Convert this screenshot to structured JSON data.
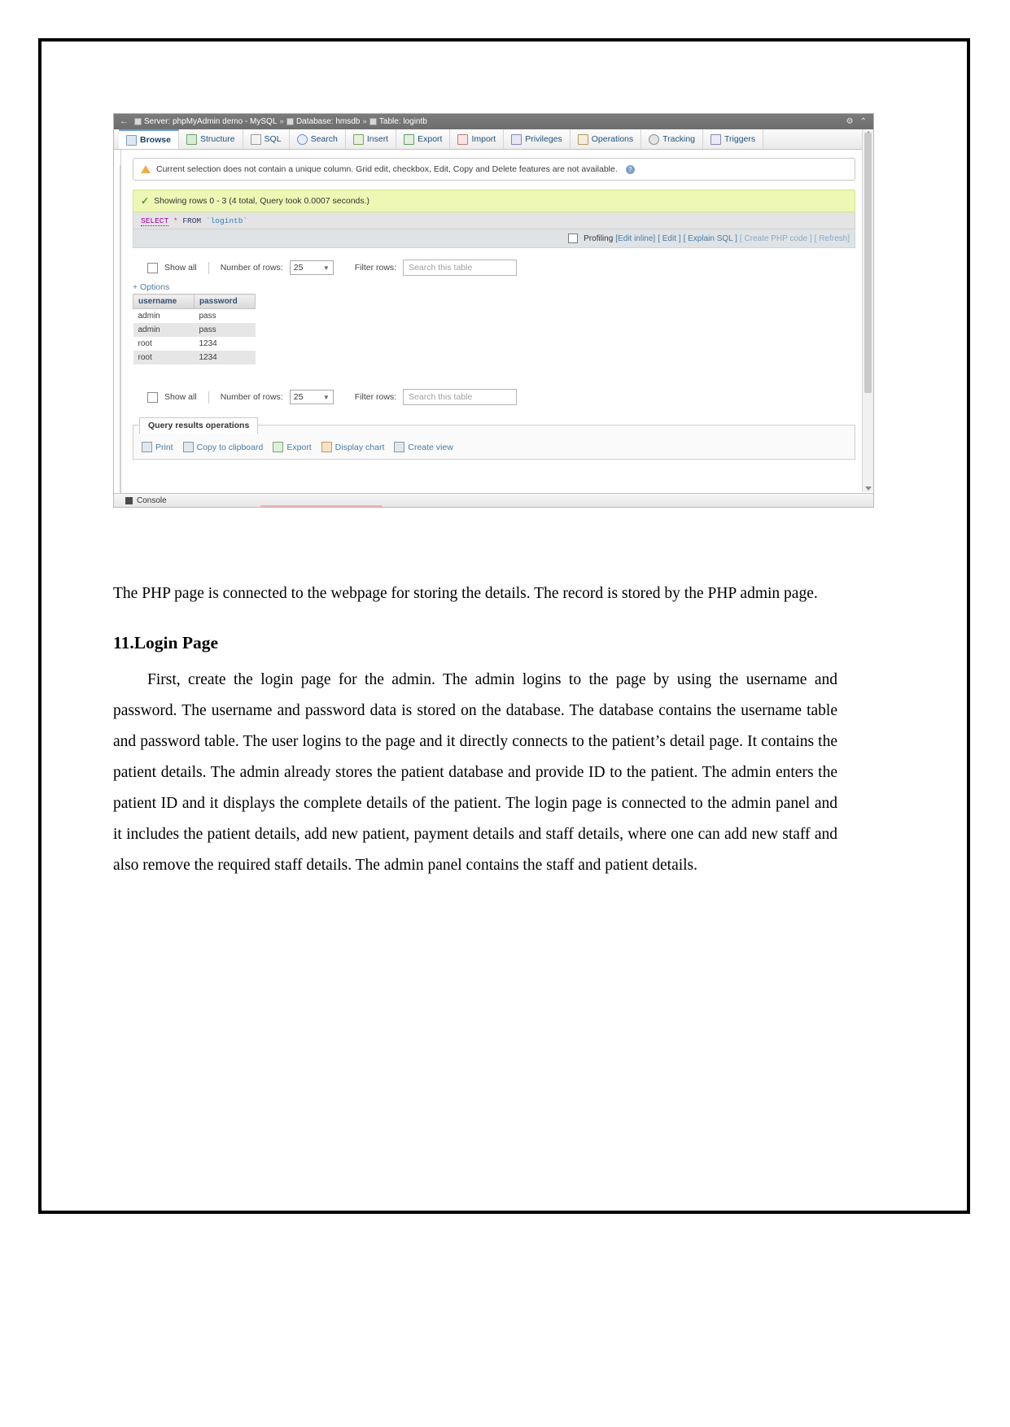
{
  "figure": {
    "titlebar": {
      "back_icon": "back-arrow-icon",
      "crumbs": [
        {
          "icon": "server-icon",
          "text": "Server: phpMyAdmin demo - MySQL"
        },
        {
          "icon": "database-icon",
          "text": "Database: hmsdb"
        },
        {
          "icon": "table-icon",
          "text": "Table: logintb"
        }
      ],
      "separator": "»",
      "settings_icon": "gear-icon",
      "collapse_icon": "collapse-icon"
    },
    "tabs": [
      {
        "label": "Browse",
        "icon": "browse-icon",
        "active": true
      },
      {
        "label": "Structure",
        "icon": "structure-icon",
        "active": false
      },
      {
        "label": "SQL",
        "icon": "sql-icon",
        "active": false
      },
      {
        "label": "Search",
        "icon": "search-icon",
        "active": false
      },
      {
        "label": "Insert",
        "icon": "insert-icon",
        "active": false
      },
      {
        "label": "Export",
        "icon": "export-icon",
        "active": false
      },
      {
        "label": "Import",
        "icon": "import-icon",
        "active": false
      },
      {
        "label": "Privileges",
        "icon": "privileges-icon",
        "active": false
      },
      {
        "label": "Operations",
        "icon": "operations-icon",
        "active": false
      },
      {
        "label": "Tracking",
        "icon": "tracking-icon",
        "active": false
      },
      {
        "label": "Triggers",
        "icon": "triggers-icon",
        "active": false
      }
    ],
    "warning_notice": {
      "icon": "warning-triangle-icon",
      "text": "Current selection does not contain a unique column. Grid edit, checkbox, Edit, Copy and Delete features are not available.",
      "help_icon": "info-icon"
    },
    "success_notice": {
      "icon": "green-check-icon",
      "text": "Showing rows 0 - 3 (4 total, Query took 0.0007 seconds.)"
    },
    "sql_query": {
      "keyword1": "SELECT",
      "star": "*",
      "keyword2": "FROM",
      "table": "`logintb`"
    },
    "profiling_bar": {
      "checkbox_label": "Profiling",
      "links": [
        "[Edit inline]",
        "[ Edit ]",
        "[ Explain SQL ]",
        "[ Create PHP code ]",
        "[ Refresh]"
      ]
    },
    "rows_bar_top": {
      "show_all_label": "Show all",
      "number_of_rows_label": "Number of rows:",
      "number_of_rows_value": "25",
      "filter_rows_label": "Filter rows:",
      "filter_placeholder": "Search this table"
    },
    "options_link": "+ Options",
    "table": {
      "columns": [
        "username",
        "password"
      ],
      "rows": [
        [
          "admin",
          "pass"
        ],
        [
          "admin",
          "pass"
        ],
        [
          "root",
          "1234"
        ],
        [
          "root",
          "1234"
        ]
      ]
    },
    "rows_bar_bottom": {
      "show_all_label": "Show all",
      "number_of_rows_label": "Number of rows:",
      "number_of_rows_value": "25",
      "filter_rows_label": "Filter rows:",
      "filter_placeholder": "Search this table"
    },
    "query_results_operations": {
      "legend": "Query results operations",
      "items": [
        {
          "label": "Print",
          "icon": "print-icon"
        },
        {
          "label": "Copy to clipboard",
          "icon": "clipboard-icon"
        },
        {
          "label": "Export",
          "icon": "export-icon"
        },
        {
          "label": "Display chart",
          "icon": "chart-icon"
        },
        {
          "label": "Create view",
          "icon": "view-icon"
        }
      ]
    },
    "console": {
      "label": "Console",
      "icon": "console-icon"
    }
  },
  "document": {
    "intro_paragraph": "The PHP page is connected to the webpage for storing the details. The record is stored by the PHP admin page.",
    "heading": "11.Login Page",
    "body_paragraph": "First, create the login page for the admin. The admin logins to the page by using the username and password. The username and password data is stored on the database. The database contains the username table and password table. The user logins to the page and it directly connects to the patient’s detail page. It contains the patient details. The admin already stores the patient database and provide ID to the patient. The admin enters the patient ID and it displays the complete details of the patient. The login page is connected to the admin panel and it includes the patient details, add new patient, payment details and staff details, where one can add new staff and also remove the required staff details. The admin panel contains the staff and patient details."
  }
}
